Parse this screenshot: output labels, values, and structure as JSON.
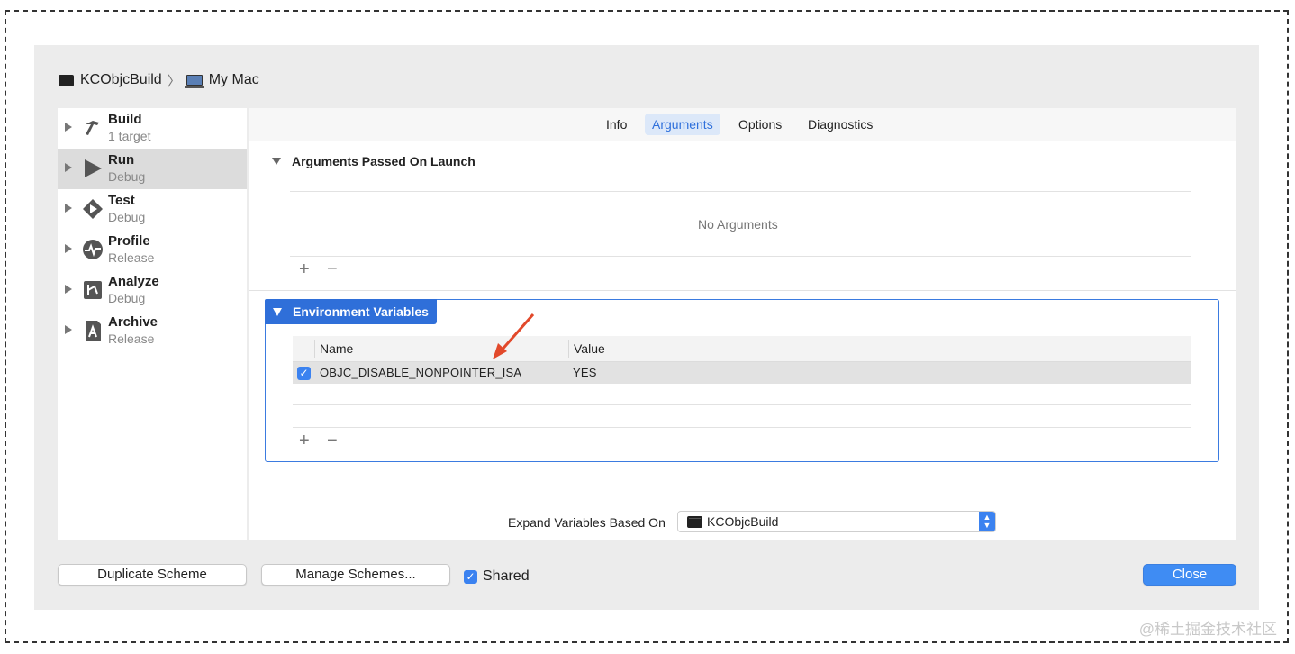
{
  "breadcrumb": {
    "scheme": "KCObjcBuild",
    "separator": "〉",
    "destination": "My Mac"
  },
  "sidebar": {
    "items": [
      {
        "title": "Build",
        "subtitle": "1 target",
        "icon": "hammer-icon"
      },
      {
        "title": "Run",
        "subtitle": "Debug",
        "icon": "play-icon"
      },
      {
        "title": "Test",
        "subtitle": "Debug",
        "icon": "test-diamond-icon"
      },
      {
        "title": "Profile",
        "subtitle": "Release",
        "icon": "instruments-icon"
      },
      {
        "title": "Analyze",
        "subtitle": "Debug",
        "icon": "analyze-icon"
      },
      {
        "title": "Archive",
        "subtitle": "Release",
        "icon": "archive-icon"
      }
    ],
    "selected": "Run"
  },
  "tabs": {
    "items": [
      "Info",
      "Arguments",
      "Options",
      "Diagnostics"
    ],
    "active": "Arguments"
  },
  "arguments": {
    "title": "Arguments Passed On Launch",
    "empty_text": "No Arguments",
    "add": "+",
    "remove": "−"
  },
  "environment": {
    "title": "Environment Variables",
    "columns": {
      "name": "Name",
      "value": "Value"
    },
    "rows": [
      {
        "enabled": true,
        "name": "OBJC_DISABLE_NONPOINTER_ISA",
        "value": "YES"
      }
    ],
    "add": "+",
    "remove": "−"
  },
  "expand": {
    "label": "Expand Variables Based On",
    "value": "KCObjcBuild"
  },
  "footer": {
    "duplicate": "Duplicate Scheme",
    "manage": "Manage Schemes...",
    "shared_label": "Shared",
    "shared_checked": true,
    "close": "Close"
  },
  "watermark": "@稀土掘金技术社区",
  "colors": {
    "accent": "#2f6fd9",
    "annotation_arrow": "#e2492b",
    "selected_row": "#dcdcdc"
  }
}
